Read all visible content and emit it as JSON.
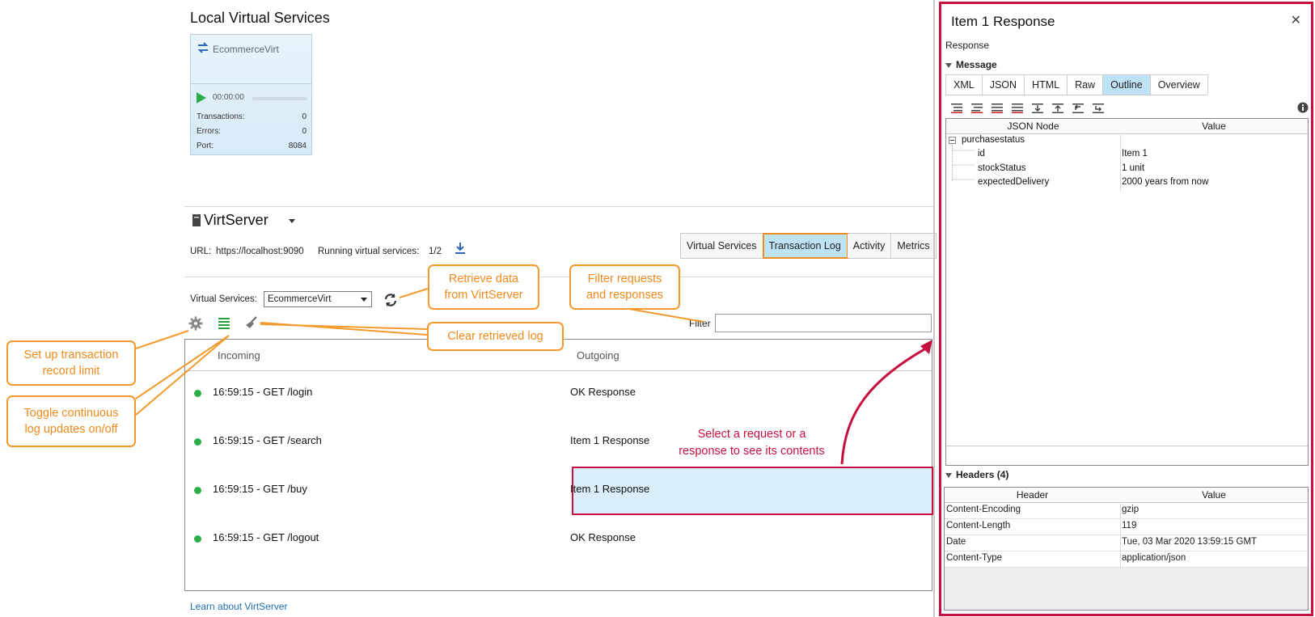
{
  "local": {
    "title": "Local Virtual Services",
    "card": {
      "name": "EcommerceVirt",
      "time": "00:00:00",
      "rows": [
        {
          "label": "Transactions:",
          "value": "0"
        },
        {
          "label": "Errors:",
          "value": "0"
        },
        {
          "label": "Port:",
          "value": "8084"
        }
      ]
    }
  },
  "virtserver": {
    "title": "VirtServer",
    "url_label": "URL:",
    "url": "https://localhost:9090",
    "running_label": "Running virtual services:",
    "running_value": "1/2",
    "tabs": [
      "Virtual Services",
      "Transaction Log",
      "Activity",
      "Metrics"
    ],
    "active_tab": "Transaction Log",
    "vs_label": "Virtual Services:",
    "vs_selected": "EcommerceVirt",
    "filter_label": "Filter",
    "columns": [
      "Incoming",
      "Outgoing"
    ],
    "rows": [
      {
        "incoming": "16:59:15 - GET /login",
        "outgoing": "OK Response"
      },
      {
        "incoming": "16:59:15 - GET /search",
        "outgoing": "Item 1 Response"
      },
      {
        "incoming": "16:59:15 - GET /buy",
        "outgoing": "Item 1 Response"
      },
      {
        "incoming": "16:59:15 - GET /logout",
        "outgoing": "OK Response"
      }
    ],
    "learn_link": "Learn about VirtServer"
  },
  "callouts": {
    "retrieve": "Retrieve data\nfrom VirtServer",
    "filter": "Filter requests\nand responses",
    "clear": "Clear retrieved log",
    "record_limit": "Set up transaction\nrecord limit",
    "toggle": "Toggle continuous\nlog updates on/off",
    "select": "Select a request or a\nresponse to see its contents"
  },
  "panel": {
    "title": "Item 1 Response",
    "response_label": "Response",
    "message_label": "Message",
    "tabs": [
      "XML",
      "JSON",
      "HTML",
      "Raw",
      "Outline",
      "Overview"
    ],
    "active_tab": "Outline",
    "json_headers": [
      "JSON Node",
      "Value"
    ],
    "json_root": "purchasestatus",
    "json_rows": [
      {
        "node": "id",
        "value": "Item 1"
      },
      {
        "node": "stockStatus",
        "value": "1 unit"
      },
      {
        "node": "expectedDelivery",
        "value": "2000 years from now"
      }
    ],
    "headers_label": "Headers (4)",
    "header_cols": [
      "Header",
      "Value"
    ],
    "header_rows": [
      {
        "name": "Content-Encoding",
        "value": "gzip"
      },
      {
        "name": "Content-Length",
        "value": "119"
      },
      {
        "name": "Date",
        "value": "Tue, 03 Mar 2020 13:59:15 GMT"
      },
      {
        "name": "Content-Type",
        "value": "application/json"
      }
    ]
  },
  "colors": {
    "accent_orange": "#f39a2d",
    "accent_red": "#c8103f",
    "selected_blue": "#bfe3f6",
    "status_green": "#2bae4a"
  }
}
